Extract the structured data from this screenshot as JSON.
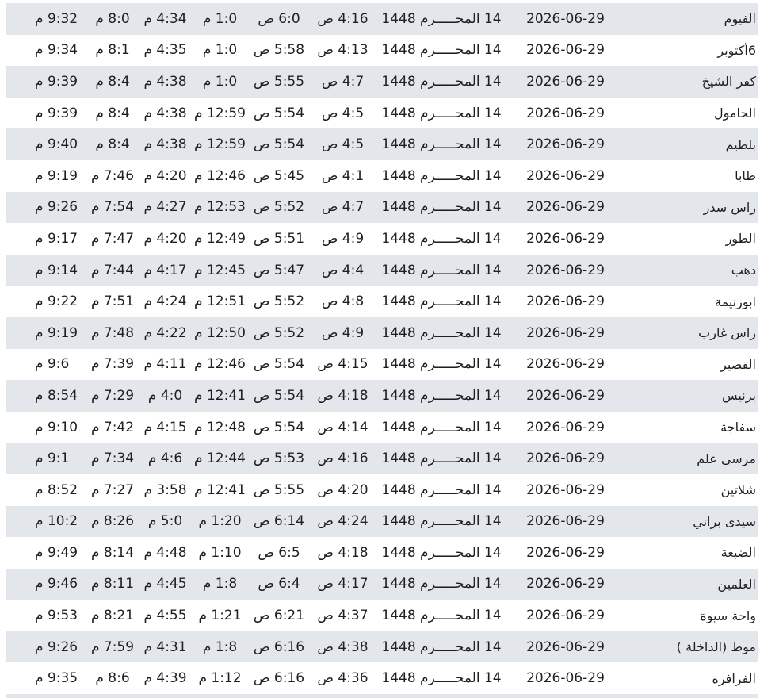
{
  "rows": [
    {
      "city": "الفيوم",
      "gregorian": "2026-06-29",
      "hijri": "14 المحـــــرم 1448",
      "fajr": "4:16 ص",
      "sunrise": "6:0 ص",
      "dhuhr": "1:0 م",
      "asr": "4:34 م",
      "maghrib": "8:0 م",
      "isha": "9:32 م"
    },
    {
      "city": "6أكتوبر",
      "gregorian": "2026-06-29",
      "hijri": "14 المحـــــرم 1448",
      "fajr": "4:13 ص",
      "sunrise": "5:58 ص",
      "dhuhr": "1:0 م",
      "asr": "4:35 م",
      "maghrib": "8:1 م",
      "isha": "9:34 م"
    },
    {
      "city": "كفر الشيخ",
      "gregorian": "2026-06-29",
      "hijri": "14 المحـــــرم 1448",
      "fajr": "4:7 ص",
      "sunrise": "5:55 ص",
      "dhuhr": "1:0 م",
      "asr": "4:38 م",
      "maghrib": "8:4 م",
      "isha": "9:39 م"
    },
    {
      "city": "الحامول",
      "gregorian": "2026-06-29",
      "hijri": "14 المحـــــرم 1448",
      "fajr": "4:5 ص",
      "sunrise": "5:54 ص",
      "dhuhr": "12:59 م",
      "asr": "4:38 م",
      "maghrib": "8:4 م",
      "isha": "9:39 م"
    },
    {
      "city": "بلطيم",
      "gregorian": "2026-06-29",
      "hijri": "14 المحـــــرم 1448",
      "fajr": "4:5 ص",
      "sunrise": "5:54 ص",
      "dhuhr": "12:59 م",
      "asr": "4:38 م",
      "maghrib": "8:4 م",
      "isha": "9:40 م"
    },
    {
      "city": "طابا",
      "gregorian": "2026-06-29",
      "hijri": "14 المحـــــرم 1448",
      "fajr": "4:1 ص",
      "sunrise": "5:45 ص",
      "dhuhr": "12:46 م",
      "asr": "4:20 م",
      "maghrib": "7:46 م",
      "isha": "9:19 م"
    },
    {
      "city": "راس سدر",
      "gregorian": "2026-06-29",
      "hijri": "14 المحـــــرم 1448",
      "fajr": "4:7 ص",
      "sunrise": "5:52 ص",
      "dhuhr": "12:53 م",
      "asr": "4:27 م",
      "maghrib": "7:54 م",
      "isha": "9:26 م"
    },
    {
      "city": "الطور",
      "gregorian": "2026-06-29",
      "hijri": "14 المحـــــرم 1448",
      "fajr": "4:9 ص",
      "sunrise": "5:51 ص",
      "dhuhr": "12:49 م",
      "asr": "4:20 م",
      "maghrib": "7:47 م",
      "isha": "9:17 م"
    },
    {
      "city": "دهب",
      "gregorian": "2026-06-29",
      "hijri": "14 المحـــــرم 1448",
      "fajr": "4:4 ص",
      "sunrise": "5:47 ص",
      "dhuhr": "12:45 م",
      "asr": "4:17 م",
      "maghrib": "7:44 م",
      "isha": "9:14 م"
    },
    {
      "city": "ابوزنيمة",
      "gregorian": "2026-06-29",
      "hijri": "14 المحـــــرم 1448",
      "fajr": "4:8 ص",
      "sunrise": "5:52 ص",
      "dhuhr": "12:51 م",
      "asr": "4:24 م",
      "maghrib": "7:51 م",
      "isha": "9:22 م"
    },
    {
      "city": "راس غارب",
      "gregorian": "2026-06-29",
      "hijri": "14 المحـــــرم 1448",
      "fajr": "4:9 ص",
      "sunrise": "5:52 ص",
      "dhuhr": "12:50 م",
      "asr": "4:22 م",
      "maghrib": "7:48 م",
      "isha": "9:19 م"
    },
    {
      "city": "القصير",
      "gregorian": "2026-06-29",
      "hijri": "14 المحـــــرم 1448",
      "fajr": "4:15 ص",
      "sunrise": "5:54 ص",
      "dhuhr": "12:46 م",
      "asr": "4:11 م",
      "maghrib": "7:39 م",
      "isha": "9:6 م"
    },
    {
      "city": "برنيس",
      "gregorian": "2026-06-29",
      "hijri": "14 المحـــــرم 1448",
      "fajr": "4:18 ص",
      "sunrise": "5:54 ص",
      "dhuhr": "12:41 م",
      "asr": "4:0 م",
      "maghrib": "7:29 م",
      "isha": "8:54 م"
    },
    {
      "city": "سفاجة",
      "gregorian": "2026-06-29",
      "hijri": "14 المحـــــرم 1448",
      "fajr": "4:14 ص",
      "sunrise": "5:54 ص",
      "dhuhr": "12:48 م",
      "asr": "4:15 م",
      "maghrib": "7:42 م",
      "isha": "9:10 م"
    },
    {
      "city": "مرسى علم",
      "gregorian": "2026-06-29",
      "hijri": "14 المحـــــرم 1448",
      "fajr": "4:16 ص",
      "sunrise": "5:53 ص",
      "dhuhr": "12:44 م",
      "asr": "4:6 م",
      "maghrib": "7:34 م",
      "isha": "9:1 م"
    },
    {
      "city": "شلاتين",
      "gregorian": "2026-06-29",
      "hijri": "14 المحـــــرم 1448",
      "fajr": "4:20 ص",
      "sunrise": "5:55 ص",
      "dhuhr": "12:41 م",
      "asr": "3:58 م",
      "maghrib": "7:27 م",
      "isha": "8:52 م"
    },
    {
      "city": "سيدى براني",
      "gregorian": "2026-06-29",
      "hijri": "14 المحـــــرم 1448",
      "fajr": "4:24 ص",
      "sunrise": "6:14 ص",
      "dhuhr": "1:20 م",
      "asr": "5:0 م",
      "maghrib": "8:26 م",
      "isha": "10:2 م"
    },
    {
      "city": "الضبعة",
      "gregorian": "2026-06-29",
      "hijri": "14 المحـــــرم 1448",
      "fajr": "4:18 ص",
      "sunrise": "6:5 ص",
      "dhuhr": "1:10 م",
      "asr": "4:48 م",
      "maghrib": "8:14 م",
      "isha": "9:49 م"
    },
    {
      "city": "العلمين",
      "gregorian": "2026-06-29",
      "hijri": "14 المحـــــرم 1448",
      "fajr": "4:17 ص",
      "sunrise": "6:4 ص",
      "dhuhr": "1:8 م",
      "asr": "4:45 م",
      "maghrib": "8:11 م",
      "isha": "9:46 م"
    },
    {
      "city": "واحة سيوة",
      "gregorian": "2026-06-29",
      "hijri": "14 المحـــــرم 1448",
      "fajr": "4:37 ص",
      "sunrise": "6:21 ص",
      "dhuhr": "1:21 م",
      "asr": "4:55 م",
      "maghrib": "8:21 م",
      "isha": "9:53 م"
    },
    {
      "city": "موط (الداخلة )",
      "gregorian": "2026-06-29",
      "hijri": "14 المحـــــرم 1448",
      "fajr": "4:38 ص",
      "sunrise": "6:16 ص",
      "dhuhr": "1:8 م",
      "asr": "4:31 م",
      "maghrib": "7:59 م",
      "isha": "9:26 م"
    },
    {
      "city": "الفرافرة",
      "gregorian": "2026-06-29",
      "hijri": "14 المحـــــرم 1448",
      "fajr": "4:36 ص",
      "sunrise": "6:16 ص",
      "dhuhr": "1:12 م",
      "asr": "4:39 م",
      "maghrib": "8:6 م",
      "isha": "9:35 م"
    }
  ],
  "colors": {
    "row_stripe": "#e3e7ec",
    "row_plain": "#ffffff",
    "text": "#1f1f1f"
  }
}
